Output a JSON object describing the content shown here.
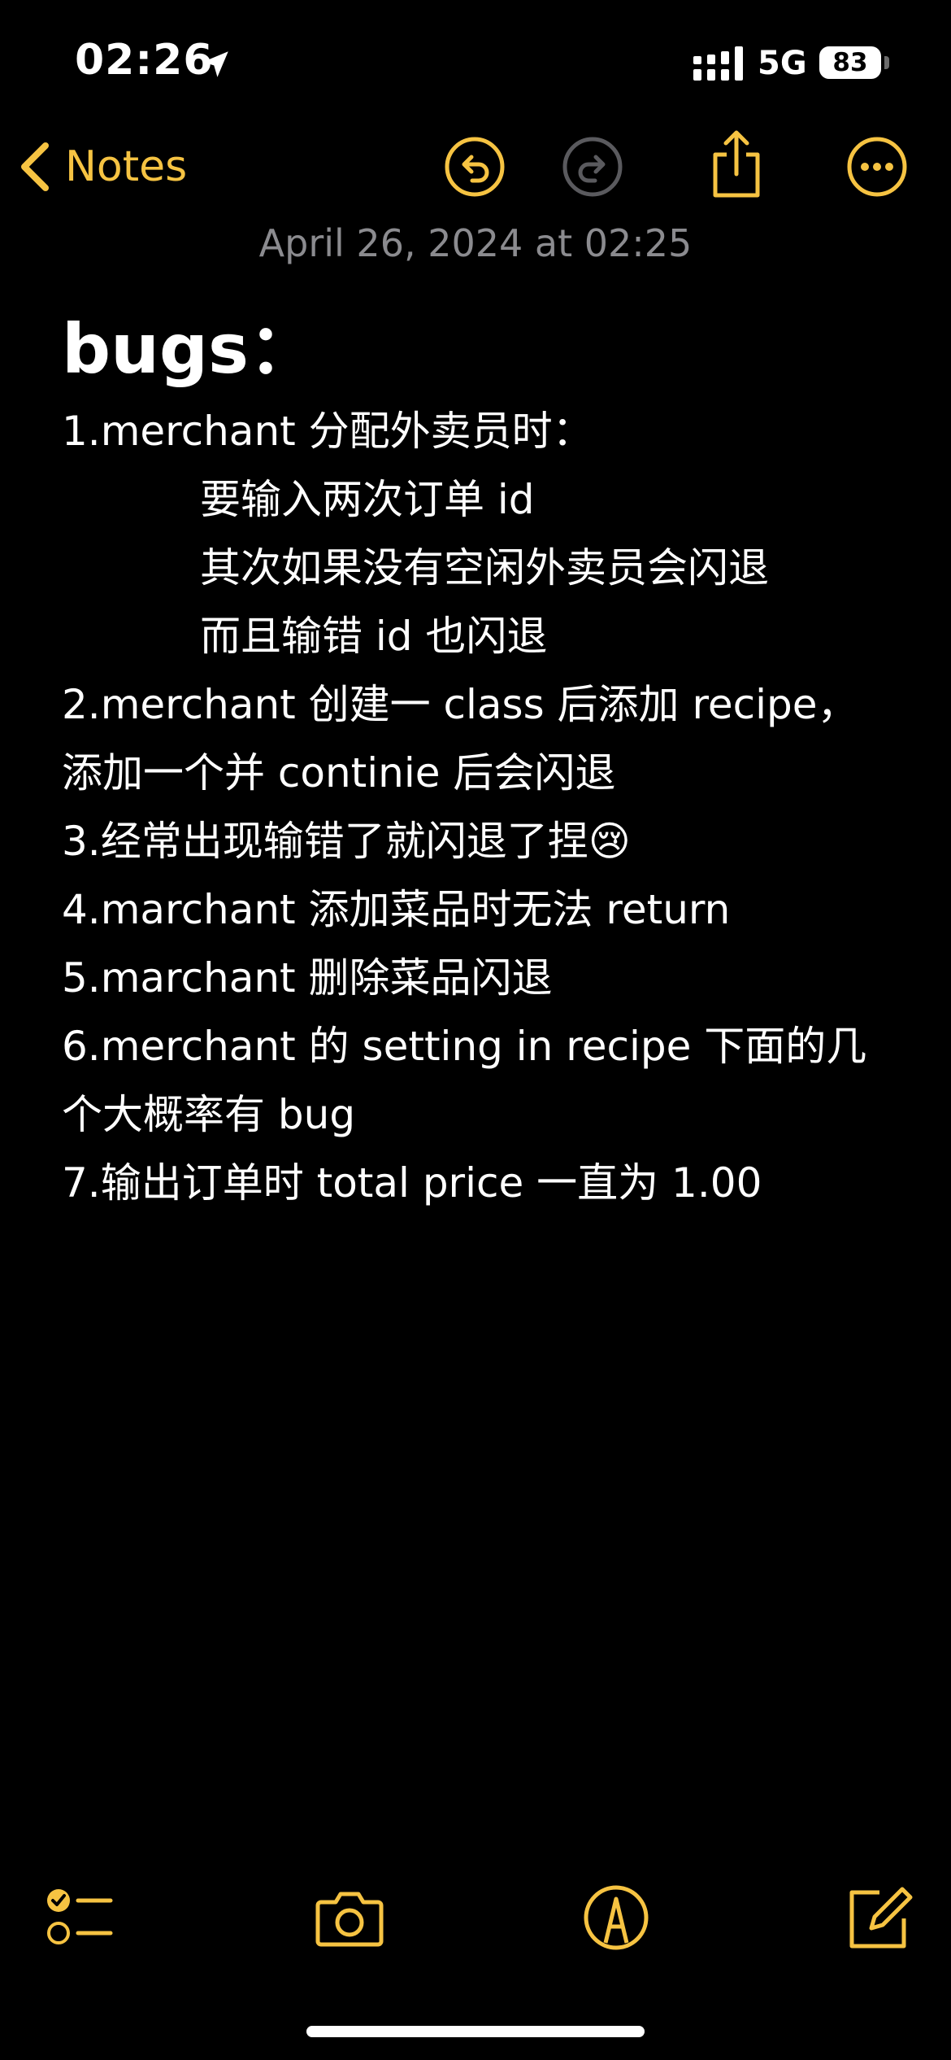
{
  "status_bar": {
    "time": "02:26",
    "network": "5G",
    "battery_level": "83",
    "icons": [
      "location-arrow-icon",
      "cellular-signal-icon",
      "battery-icon"
    ]
  },
  "nav": {
    "back_label": "Notes",
    "icons": [
      "chevron-left-icon",
      "undo-icon",
      "redo-icon",
      "share-icon",
      "more-icon"
    ]
  },
  "note": {
    "date": "April 26, 2024 at 02:25",
    "title": "bugs：",
    "lines": [
      "1.merchant 分配外卖员时：",
      "要输入两次订单 id",
      "其次如果没有空闲外卖员会闪退",
      "而且输错 id 也闪退",
      "2.merchant 创建一 class 后添加 recipe，",
      "添加一个并 continie 后会闪退",
      "3.经常出现输错了就闪退了捏😢",
      "4.marchant 添加菜品时无法 return",
      "5.marchant 删除菜品闪退",
      "6.merchant 的 setting in recipe 下面的几",
      "个大概率有 bug",
      "7.输出订单时 total price 一直为 1.00"
    ]
  },
  "toolbar": {
    "icons": [
      "checklist-icon",
      "camera-icon",
      "markup-icon",
      "compose-icon"
    ]
  },
  "colors": {
    "accent": "#f6c342",
    "background": "#000000",
    "text": "#ffffff",
    "secondary_text": "#8b8b8f",
    "disabled": "#5a5a5e"
  }
}
